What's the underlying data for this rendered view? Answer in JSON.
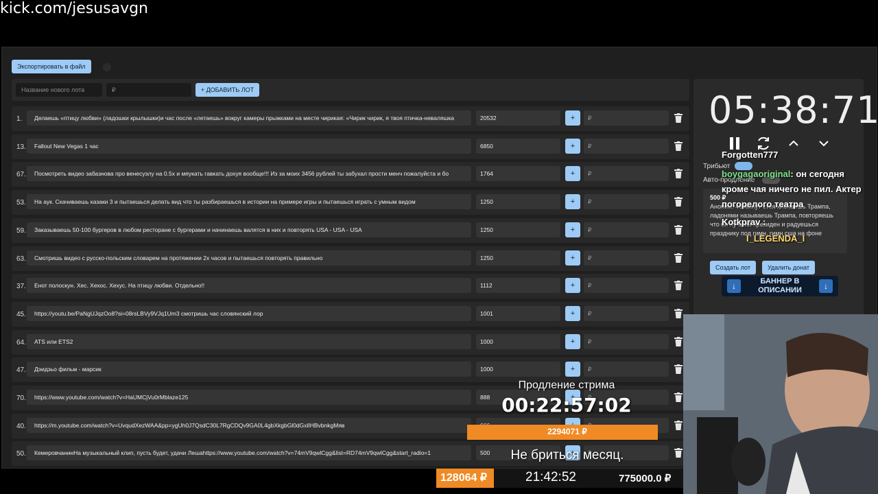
{
  "stream_url": "kick.com/jesusavgn",
  "toolbar": {
    "export_label": "Экспортировать в файл"
  },
  "add_lot": {
    "name_placeholder": "Название нового лота",
    "price_placeholder": "₽",
    "add_label": "+ ДОБАВИТЬ ЛОТ"
  },
  "lots": [
    {
      "num": "1.",
      "name": "Делаешь «птицу любви» (ладошки крылышки)и час после «летаешь» вокруг камеры прыжками на месте чирикая: «Чирик чирик, я твоя птичка-неваляшка",
      "value": "20532",
      "plus": "+",
      "rub": "₽"
    },
    {
      "num": "13.",
      "name": "Fallout New Vegas 1 час",
      "value": "6850",
      "plus": "+",
      "rub": "₽"
    },
    {
      "num": "67.",
      "name": "Посмотреть видео забазнова про венесуэлу на 0.5x и мяукать гавкать дохуя вообще!!! Из за моих 3456 рублей ты забухал прости менч пожалуйста и бо",
      "value": "1764",
      "plus": "+",
      "rub": "₽"
    },
    {
      "num": "53.",
      "name": "На аук. Скачиваешь казаки 3 и пытаешься делать вид что ты разбираешься в истории на примере игры и пытаешься играть с умным видом",
      "value": "1250",
      "plus": "+",
      "rub": "₽"
    },
    {
      "num": "59.",
      "name": "Заказываешь 50-100 бургеров в любом ресторане с бургерами и начинаешь валятся в них и повторять USA - USA - USA",
      "value": "1250",
      "plus": "+",
      "rub": "₽"
    },
    {
      "num": "63.",
      "name": "Смотришь видео с русско-польским словарем на протяжении 2х часов и пытаешься повторять правильно",
      "value": "1250",
      "plus": "+",
      "rub": "₽"
    },
    {
      "num": "37.",
      "name": "Енот полоскун. Хес. Хехос. Хехус. На птицу любви. Отдельно!!",
      "value": "1112",
      "plus": "+",
      "rub": "₽"
    },
    {
      "num": "45.",
      "name": "https://youtu.be/PaNgUJqzOo8?si=08rsLBVy9VJq1Um3 смотришь час словянский лор",
      "value": "1001",
      "plus": "+",
      "rub": "₽"
    },
    {
      "num": "64.",
      "name": "ATS или ETS2",
      "value": "1000",
      "plus": "+",
      "rub": "₽"
    },
    {
      "num": "47.",
      "name": "Дэидзьо фильм - марсик",
      "value": "1000",
      "plus": "+",
      "rub": "₽"
    },
    {
      "num": "70.",
      "name": "https://www.youtube.com/watch?v=HaUMCjVu0rMblaze125",
      "value": "888",
      "plus": "+",
      "rub": "₽"
    },
    {
      "num": "40.",
      "name": "https://m.youtube.com/watch?v=UvqudXezWAA&pp=ygUh0J7QsdC30L7RgCDQv9GA0L4gbXkgbGl0dGxlIHBvbnkgMяв",
      "value": "666",
      "plus": "+",
      "rub": "₽"
    },
    {
      "num": "50.",
      "name": "КемеровчанинНа музыкальный клип, пусть будет, удачи Лешаhttps://www.youtube.com/watch?v=74mV9qwlCgg&list=RD74mV9qwlCgg&start_radio=1",
      "value": "500",
      "plus": "+",
      "rub": "₽"
    }
  ],
  "side": {
    "timer": "05:38:71",
    "tribut_label": "Трибьют",
    "auto_label": "Авто-продление",
    "donate_amount": "500 ₽",
    "donate_text": "Аноним: 40 минут стоя хлопаешь Трампа, ладонями называешь Трампа, повторяешь что он лучший президен и радуешься празднику под гимн. гимн сша на фоне",
    "create_lot": "Создать лот",
    "delete_donate": "Удалить донат"
  },
  "chat": {
    "line1": "Forgotten777",
    "line2_user": "boygagaoriginal",
    "line2_text": ": он сегодня",
    "line3": "кроме чая ничего не пил. Актер",
    "line4": "погорелого театра",
    "line5": "Kotkprav :",
    "line6": "I_LEGENDA_I"
  },
  "banner": {
    "text": "БАННЕР В ОПИСАНИИ"
  },
  "extension": {
    "label": "Продление стрима",
    "timer": "00:22:57:02",
    "bar_value": "2294071 ₽"
  },
  "subtitle": "Не бриться месяц.",
  "bottom": {
    "left": "128064 ₽",
    "mid": "21:42:52",
    "right": "775000.0 ₽"
  },
  "colors": {
    "accent": "#9ecbf5",
    "orange": "#f08a24",
    "bg": "#1f1f1f"
  }
}
